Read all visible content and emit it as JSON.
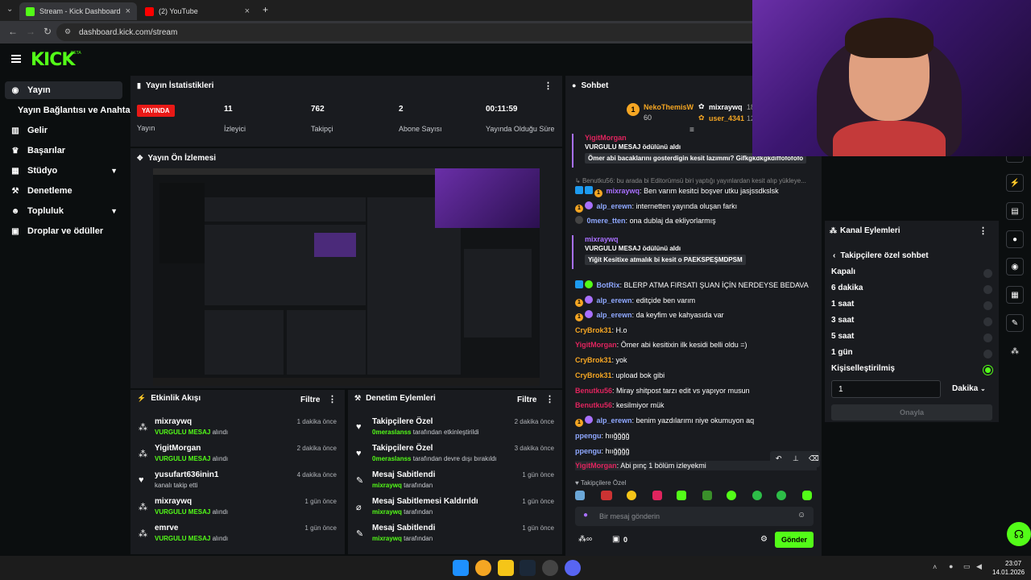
{
  "browser": {
    "tabs": [
      {
        "title": "Stream - Kick Dashboard",
        "active": true
      },
      {
        "title": "(2) YouTube",
        "active": false
      }
    ],
    "url": "dashboard.kick.com/stream"
  },
  "brand": {
    "logo": "KICK",
    "beta": "BETA",
    "accent": "#53fc18"
  },
  "sidebar": {
    "items": [
      {
        "label": "Yayın",
        "icon": "broadcast-icon"
      },
      {
        "label": "Yayın Bağlantısı ve Anahtarı"
      },
      {
        "label": "Gelir",
        "icon": "chart-icon"
      },
      {
        "label": "Başarılar",
        "icon": "trophy-icon"
      },
      {
        "label": "Stüdyo",
        "icon": "grid-icon"
      },
      {
        "label": "Denetleme",
        "icon": "hammer-icon"
      },
      {
        "label": "Topluluk",
        "icon": "people-icon"
      },
      {
        "label": "Droplar ve ödüller",
        "icon": "gift-icon"
      }
    ]
  },
  "stats": {
    "title": "Yayın İstatistikleri",
    "live_badge": "YAYINDA",
    "items": [
      {
        "value": "YAYINDA",
        "label": "Yayın"
      },
      {
        "value": "11",
        "label": "İzleyici"
      },
      {
        "value": "762",
        "label": "Takipçi"
      },
      {
        "value": "2",
        "label": "Abone Sayısı"
      },
      {
        "value": "00:11:59",
        "label": "Yayında Olduğu Süre"
      }
    ]
  },
  "preview": {
    "title": "Yayın Ön İzlemesi"
  },
  "activity": {
    "title": "Etkinlik Akışı",
    "filter": "Filtre",
    "items": [
      {
        "name": "mixraywq",
        "highlight": "VURGULU MESAJ",
        "rest": "alındı",
        "time": "1 dakika önce"
      },
      {
        "name": "YigitMorgan",
        "highlight": "VURGULU MESAJ",
        "rest": "alındı",
        "time": "2 dakika önce"
      },
      {
        "name": "yusufart636inin1",
        "highlight": "",
        "rest": "kanalı takip etti",
        "time": "4 dakika önce"
      },
      {
        "name": "mixraywq",
        "highlight": "VURGULU MESAJ",
        "rest": "alındı",
        "time": "1 gün önce"
      },
      {
        "name": "emrve",
        "highlight": "VURGULU MESAJ",
        "rest": "alındı",
        "time": "1 gün önce"
      }
    ]
  },
  "moderation": {
    "title": "Denetim Eylemleri",
    "filter": "Filtre",
    "items": [
      {
        "name": "Takipçilere Özel",
        "user": "0meraslanss",
        "rest": "tarafından etkinleştirildi",
        "time": "2 dakika önce"
      },
      {
        "name": "Takipçilere Özel",
        "user": "0meraslanss",
        "rest": "tarafından devre dışı bırakıldı",
        "time": "3 dakika önce"
      },
      {
        "name": "Mesaj Sabitlendi",
        "user": "mixraywq",
        "rest": "tarafından",
        "time": "1 gün önce"
      },
      {
        "name": "Mesaj Sabitlemesi Kaldırıldı",
        "user": "mixraywq",
        "rest": "tarafından",
        "time": "1 gün önce"
      },
      {
        "name": "Mesaj Sabitlendi",
        "user": "mixraywq",
        "rest": "tarafından",
        "time": "1 gün önce"
      }
    ]
  },
  "chat": {
    "title": "Sohbet",
    "top_gifters": [
      {
        "name": "NekoThemisW",
        "count": "60",
        "rank": "1"
      },
      {
        "name": "mixraywq",
        "count": "18"
      },
      {
        "name": "user_4341",
        "count": "12"
      }
    ],
    "gift1": {
      "user": "YigitMorgan",
      "line": "VURGULU MESAJ ödülünü aldı",
      "msg": "Ömer abi bacaklarını gosterdigin kesit lazımmı? Gifkgkdkgkdiffofofofo"
    },
    "reply": "Benutku56: bu arada bi Editorümsü biri yaptığı yayınlardan kesit alıp yükleye...",
    "gift2": {
      "user": "mixraywq",
      "line": "VURGULU MESAJ ödülünü aldı",
      "msg": "Yiğit Kesitixe atmalık bi kesit o PAEKSPEŞMDPSM"
    },
    "messages": [
      {
        "user": "mixraywq",
        "color": "#a970ff",
        "text": "Ben varım kesitci boşver utku jasjssdkslsk"
      },
      {
        "user": "alp_erewn",
        "color": "#8fa8ff",
        "text": "internetten yayında oluşan farkı"
      },
      {
        "user": "0mere_tten",
        "color": "#8fa8ff",
        "text": "ona dublaj da ekliyorlarmış"
      },
      {
        "user": "BotRix",
        "color": "#8fa8ff",
        "text": "BLERP ATMA FIRSATI ŞUAN İÇİN NERDEYSE BEDAVA"
      },
      {
        "user": "alp_erewn",
        "color": "#8fa8ff",
        "text": "editçide ben varım"
      },
      {
        "user": "alp_erewn",
        "color": "#8fa8ff",
        "text": "da keyfim ve kahyasıda var"
      },
      {
        "user": "CryBrok31",
        "color": "#f5a623",
        "text": "H.o"
      },
      {
        "user": "YigitMorgan",
        "color": "#e0245e",
        "text": "Ömer abi kesitixin ilk kesidi belli oldu =)"
      },
      {
        "user": "CryBrok31",
        "color": "#f5a623",
        "text": "yok"
      },
      {
        "user": "CryBrok31",
        "color": "#f5a623",
        "text": "upload bok gibi"
      },
      {
        "user": "Benutku56",
        "color": "#e0245e",
        "text": "Miray shitpost tarzı edit vs yapıyor musun"
      },
      {
        "user": "Benutku56",
        "color": "#e0245e",
        "text": "kesilmiyor mük"
      },
      {
        "user": "alp_erewn",
        "color": "#8fa8ff",
        "text": "benim yazdılarımı niye okumuyon aq"
      },
      {
        "user": "ppengu",
        "color": "#8fa8ff",
        "text": "hıığğğğ"
      },
      {
        "user": "ppengu",
        "color": "#8fa8ff",
        "text": "hıığğğğ"
      },
      {
        "user": "YigitMorgan",
        "color": "#e0245e",
        "text": "Abi pınç 1 bölüm izleyekmi"
      }
    ],
    "followers_only": "Takipçilere Özel",
    "input_placeholder": "Bir mesaj gönderin",
    "points": "0",
    "send": "Gönder"
  },
  "channel_actions": {
    "title": "Kanal Eylemleri",
    "sub": "Takipçilere özel sohbet",
    "options": [
      "Kapalı",
      "6 dakika",
      "1 saat",
      "3 saat",
      "5 saat",
      "1 gün",
      "Kişiselleştirilmiş"
    ],
    "selected": "Kişiselleştirilmiş",
    "custom_value": "1",
    "unit": "Dakika",
    "confirm": "Onayla"
  },
  "taskbar": {
    "time": "23:07",
    "date": "14.01.2026"
  }
}
